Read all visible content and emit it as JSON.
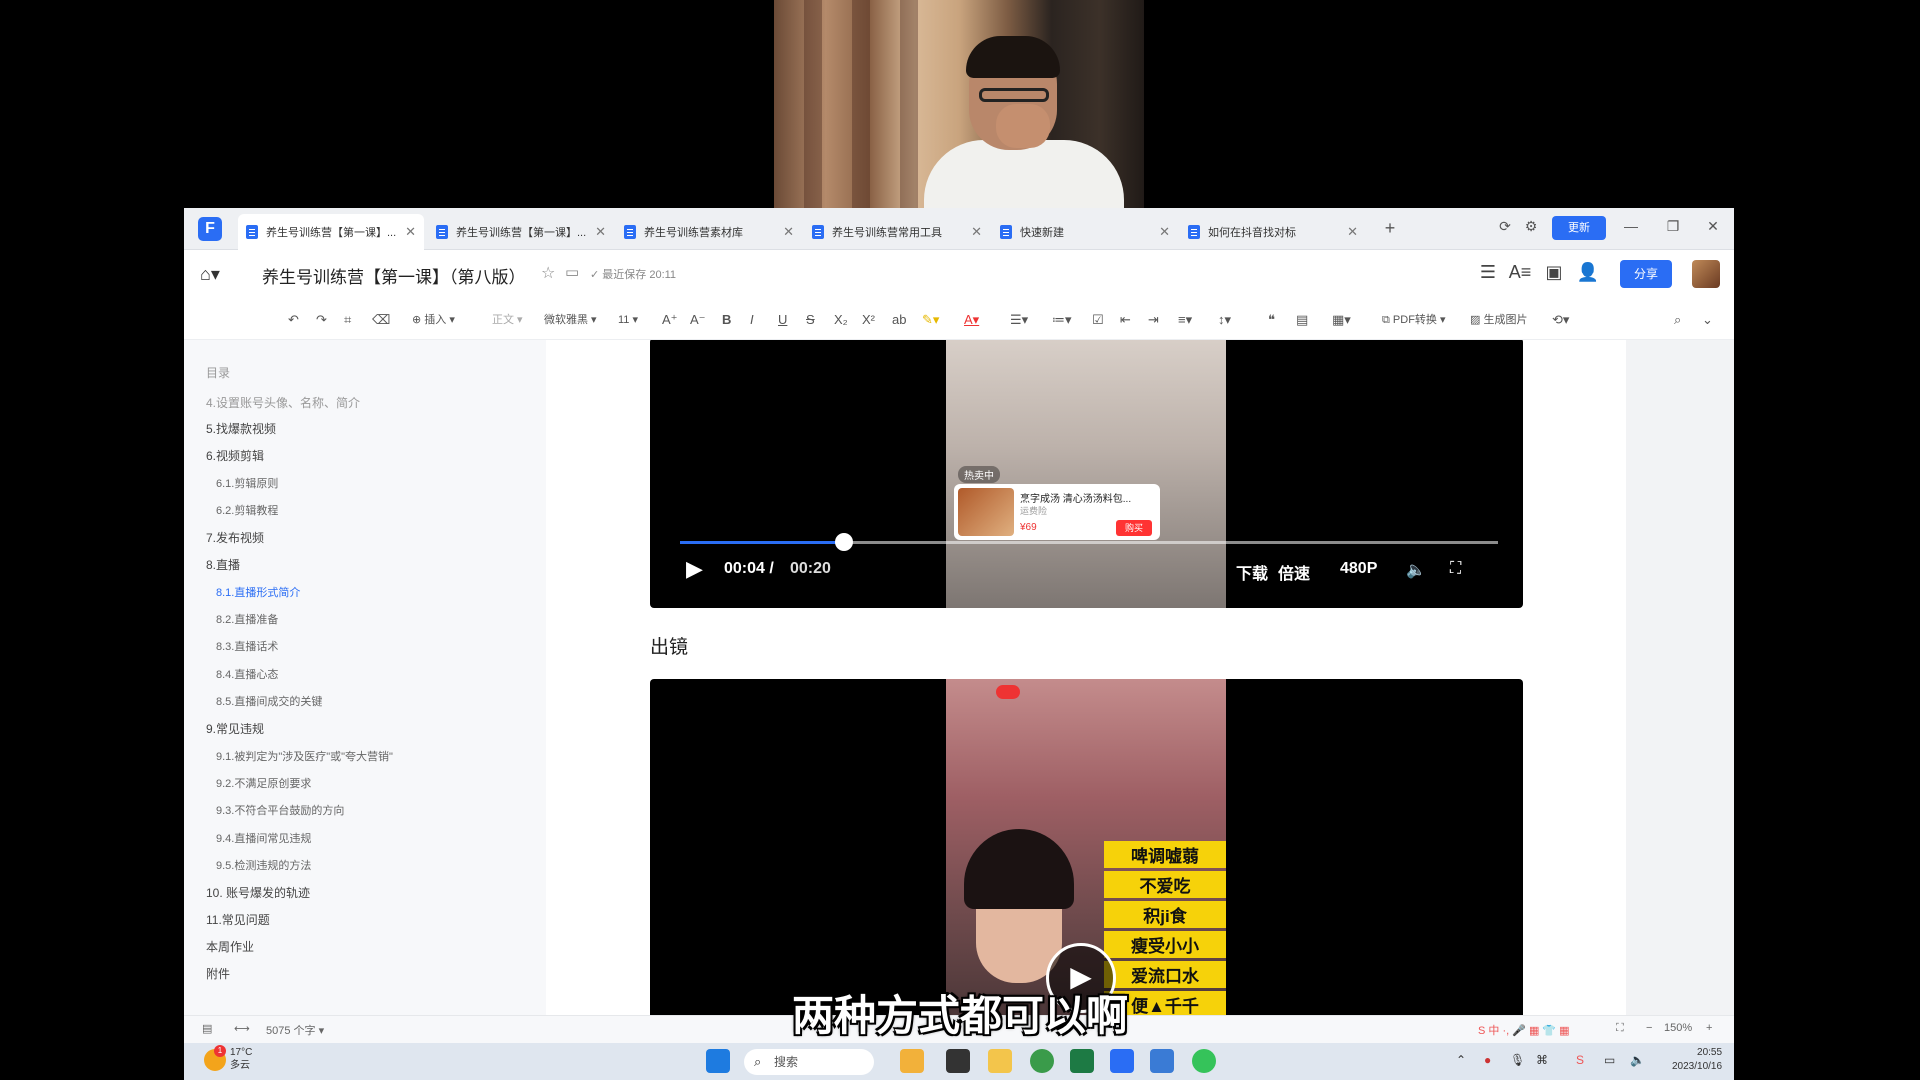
{
  "tabs": [
    {
      "label": "养生号训练营【第一课】...",
      "active": true
    },
    {
      "label": "养生号训练营【第一课】...",
      "active": false
    },
    {
      "label": "养生号训练营素材库",
      "active": false
    },
    {
      "label": "养生号训练营常用工具",
      "active": false
    },
    {
      "label": "快速新建",
      "active": false
    },
    {
      "label": "如何在抖音找对标",
      "active": false
    }
  ],
  "header": {
    "update_label": "更新",
    "doc_title": "养生号训练营【第一课】（第八版）",
    "save_status": "最近保存 20:11",
    "share_label": "分享"
  },
  "toolbar": {
    "insert": "插入",
    "style": "正文",
    "font": "微软雅黑",
    "size": "11",
    "pdf": "PDF转换",
    "image": "生成图片"
  },
  "toc": {
    "heading": "目录",
    "items": [
      {
        "label": "4.设置账号头像、名称、简介",
        "level": 1
      },
      {
        "label": "5.找爆款视频",
        "level": 1
      },
      {
        "label": "6.视频剪辑",
        "level": 1
      },
      {
        "label": "6.1.剪辑原则",
        "level": 2
      },
      {
        "label": "6.2.剪辑教程",
        "level": 2
      },
      {
        "label": "7.发布视频",
        "level": 1
      },
      {
        "label": "8.直播",
        "level": 1
      },
      {
        "label": "8.1.直播形式简介",
        "level": 2,
        "active": true
      },
      {
        "label": "8.2.直播准备",
        "level": 2
      },
      {
        "label": "8.3.直播话术",
        "level": 2
      },
      {
        "label": "8.4.直播心态",
        "level": 2
      },
      {
        "label": "8.5.直播间成交的关键",
        "level": 2
      },
      {
        "label": "9.常见违规",
        "level": 1
      },
      {
        "label": "9.1.被判定为\"涉及医疗\"或\"夸大营销\"",
        "level": 2
      },
      {
        "label": "9.2.不满足原创要求",
        "level": 2
      },
      {
        "label": "9.3.不符合平台鼓励的方向",
        "level": 2
      },
      {
        "label": "9.4.直播间常见违规",
        "level": 2
      },
      {
        "label": "9.5.检测违规的方法",
        "level": 2
      },
      {
        "label": "10. 账号爆发的轨迹",
        "level": 1
      },
      {
        "label": "11.常见问题",
        "level": 1
      },
      {
        "label": "本周作业",
        "level": 1
      },
      {
        "label": "附件",
        "level": 1
      }
    ]
  },
  "video1": {
    "current_time": "00:04",
    "separator": "/",
    "total_time": "00:20",
    "progress": 0.2,
    "download": "下载",
    "speed": "倍速",
    "quality": "480P",
    "product_name": "烹字成汤 清心汤汤料包...",
    "product_sub": "运费险",
    "product_price": "¥69",
    "buy_label": "购买",
    "hot_label": "热卖中"
  },
  "section_heading": "出镜",
  "video2": {
    "badges": [
      "啤调嘘蒻",
      "不爱吃",
      "积ji食",
      "瘦受小小",
      "爱流口水",
      "便▲千千"
    ]
  },
  "statusbar": {
    "word_count": "5075 个字",
    "zoom": "150%"
  },
  "subtitle": "两种方式都可以啊",
  "taskbar": {
    "temp": "17°C",
    "weather": "多云",
    "badge": "1",
    "search": "搜索",
    "time": "20:55",
    "date": "2023/10/16"
  }
}
